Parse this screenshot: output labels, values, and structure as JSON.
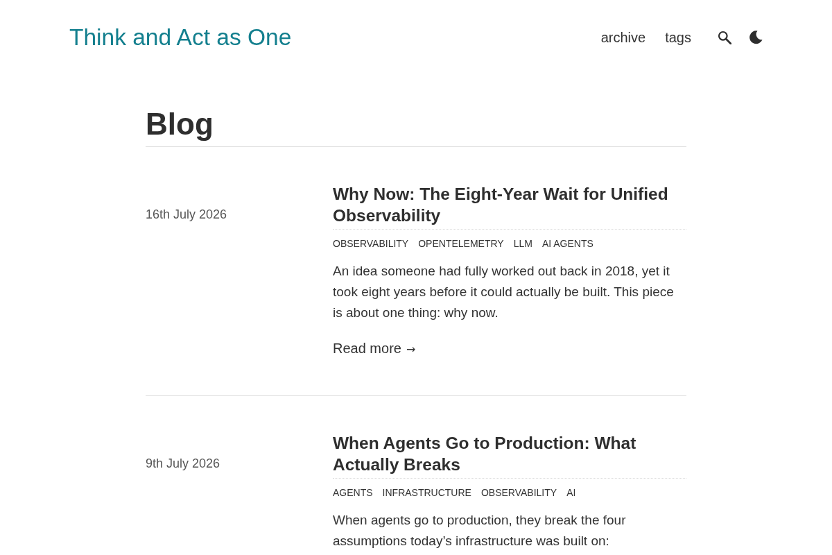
{
  "header": {
    "site_title": "Think and Act as One",
    "nav": [
      {
        "label": "archive"
      },
      {
        "label": "tags"
      }
    ]
  },
  "page": {
    "title": "Blog"
  },
  "posts": [
    {
      "date": "16th July 2026",
      "title": "Why Now: The Eight-Year Wait for Unified Observability",
      "tags": [
        "OBSERVABILITY",
        "OPENTELEMETRY",
        "LLM",
        "AI AGENTS"
      ],
      "excerpt": "An idea someone had fully worked out back in 2018, yet it took eight years before it could actually be built. This piece is about one thing: why now.",
      "read_more": {
        "label": "Read more",
        "arrow": "→"
      }
    },
    {
      "date": "9th July 2026",
      "title": "When Agents Go to Production: What Actually Breaks",
      "tags": [
        "AGENTS",
        "INFRASTRUCTURE",
        "OBSERVABILITY",
        "AI"
      ],
      "excerpt": "When agents go to production, they break the four assumptions today’s infrastructure was built on:"
    }
  ]
}
